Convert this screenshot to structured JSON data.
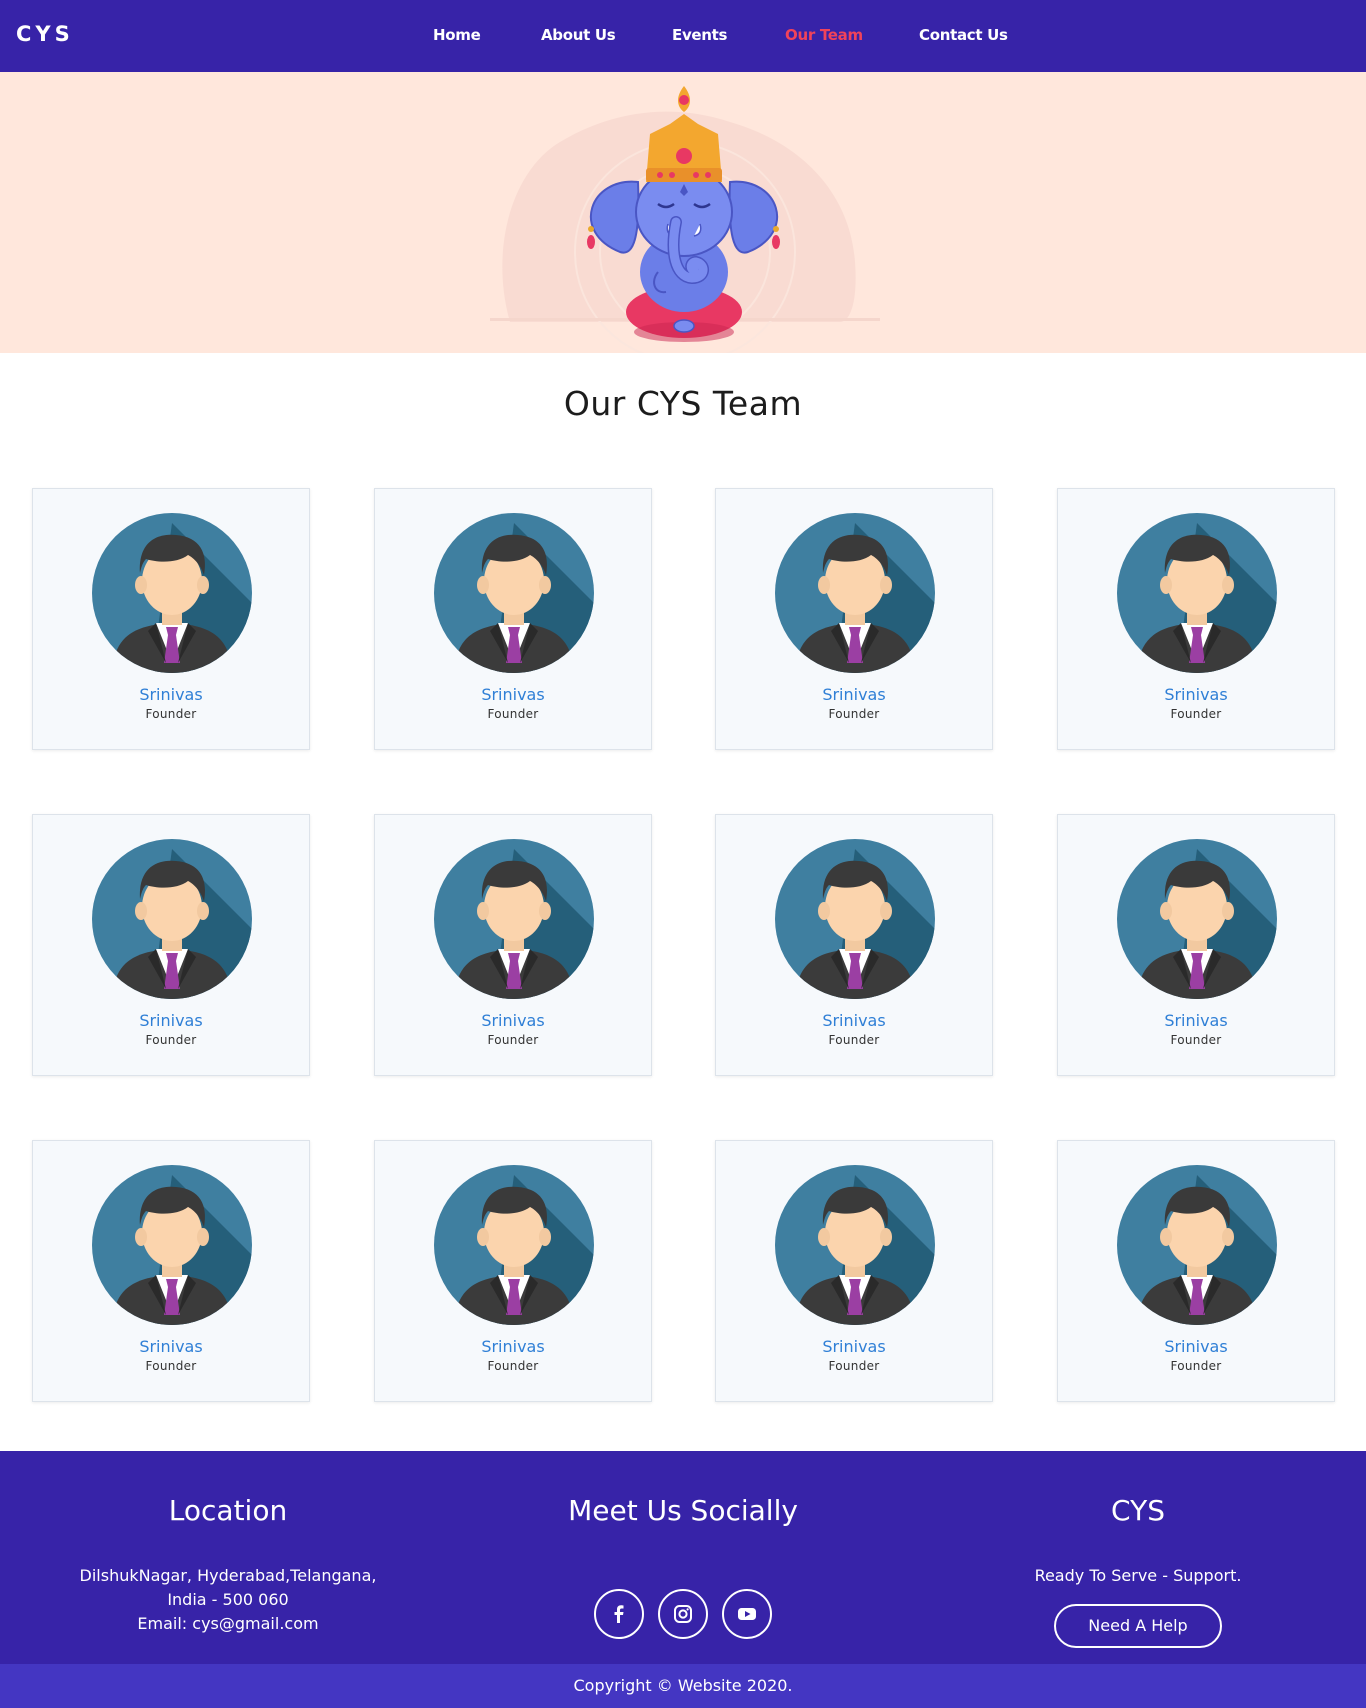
{
  "nav": {
    "brand": "CYS",
    "links": [
      {
        "label": "Home",
        "active": false
      },
      {
        "label": "About Us",
        "active": false
      },
      {
        "label": "Events",
        "active": false
      },
      {
        "label": "Our Team",
        "active": true
      },
      {
        "label": "Contact Us",
        "active": false
      }
    ]
  },
  "hero": {
    "illustration": "ganesha-illustration"
  },
  "page_title": "Our CYS Team",
  "team": [
    {
      "name": "Srinivas",
      "role": "Founder"
    },
    {
      "name": "Srinivas",
      "role": "Founder"
    },
    {
      "name": "Srinivas",
      "role": "Founder"
    },
    {
      "name": "Srinivas",
      "role": "Founder"
    },
    {
      "name": "Srinivas",
      "role": "Founder"
    },
    {
      "name": "Srinivas",
      "role": "Founder"
    },
    {
      "name": "Srinivas",
      "role": "Founder"
    },
    {
      "name": "Srinivas",
      "role": "Founder"
    },
    {
      "name": "Srinivas",
      "role": "Founder"
    },
    {
      "name": "Srinivas",
      "role": "Founder"
    },
    {
      "name": "Srinivas",
      "role": "Founder"
    },
    {
      "name": "Srinivas",
      "role": "Founder"
    }
  ],
  "footer": {
    "location": {
      "heading": "Location",
      "line1": "DilshukNagar, Hyderabad,Telangana,",
      "line2": "India - 500 060",
      "line3": "Email: cys@gmail.com"
    },
    "social": {
      "heading": "Meet Us Socially",
      "icons": [
        "facebook-icon",
        "instagram-icon",
        "youtube-icon"
      ]
    },
    "about": {
      "heading": "CYS",
      "tagline": "Ready To Serve - Support.",
      "button": "Need A Help"
    },
    "copyright": "Copyright © Website 2020."
  },
  "colors": {
    "nav_bg": "#3723a8",
    "accent_active": "#f0435a",
    "hero_bg": "#ffe7dc",
    "member_name": "#2f7fd6",
    "copyright_bg": "#4436c2"
  }
}
